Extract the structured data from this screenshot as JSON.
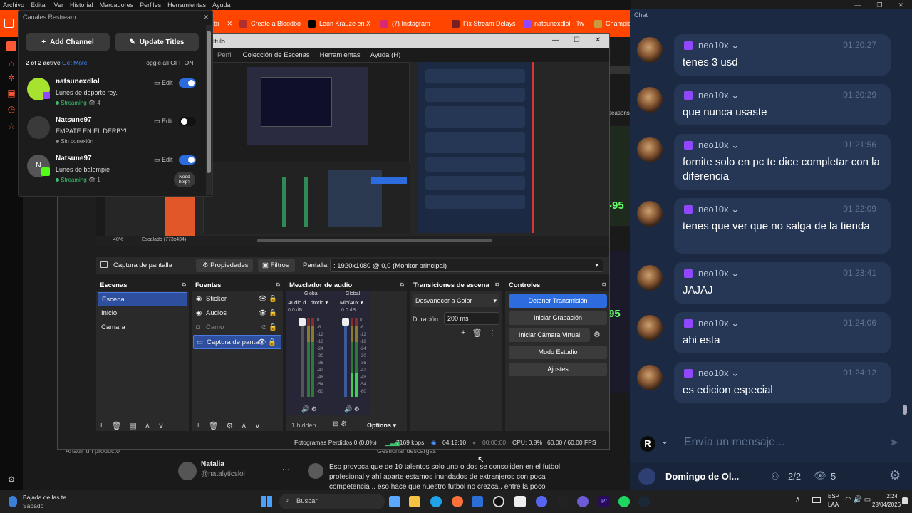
{
  "browser": {
    "menu": [
      "Archivo",
      "Editar",
      "Ver",
      "Historial",
      "Marcadores",
      "Perfiles",
      "Herramientas",
      "Ayuda"
    ],
    "tabs": [
      {
        "label": "Create a Bloodbo",
        "color": "#b03030"
      },
      {
        "label": "León Krauze en X",
        "color": "#000000"
      },
      {
        "label": "(7) Instagram",
        "color": "#d62976"
      },
      {
        "label": "Fix Stream Delays",
        "color": "#7a1f1f"
      },
      {
        "label": "natsunexdlol - Tw",
        "color": "#9146ff"
      },
      {
        "label": "Champion",
        "color": "#c89b3c"
      }
    ],
    "partial_text": {
      "seasons": "seasons",
      "ninetyfive": "-95",
      "ninetyfive2": "95"
    }
  },
  "restream": {
    "window_title": "Canales Restream",
    "add_channel": "Add Channel",
    "update_titles": "Update Titles",
    "active_count": "2 of 2 active",
    "get_more": "Get More",
    "toggle_all": "Toggle all OFF",
    "toggle_on": "ON",
    "need_help": "Need help?",
    "edit_label": "Edit",
    "channels": [
      {
        "name": "natsunexdlol",
        "title": "Lunes de deporte rey.",
        "status": "Streaming",
        "viewers": "4",
        "on": true,
        "status_color": "#3fbf6f"
      },
      {
        "name": "Natsune97",
        "title": "EMPATE EN EL DERBY!",
        "status": "Sin conexión",
        "viewers": "",
        "on": false,
        "status_color": "#888888"
      },
      {
        "name": "Natsune97",
        "title": "Lunes de balompie",
        "status": "Streaming",
        "viewers": "1",
        "on": true,
        "status_color": "#3fbf6f"
      }
    ]
  },
  "obs": {
    "title": "n Título",
    "menu": [
      "Perfil",
      "Colección de Escenas",
      "Herramientas",
      "Ayuda (H)"
    ],
    "zoom": "40%",
    "scale": "Escalado (773x434)",
    "source_bar": {
      "name": "Captura de pantalla",
      "props": "Propiedades",
      "filters": "Filtros",
      "screen_label": "Pantalla",
      "screen_value": ": 1920x1080 @ 0,0 (Monitor principal)"
    },
    "scenes": {
      "title": "Escenas",
      "items": [
        "Escena",
        "Inicio",
        "Camara"
      ]
    },
    "sources": {
      "title": "Fuentes",
      "items": [
        "Sticker",
        "Audios",
        "Camo",
        "Captura de panta"
      ]
    },
    "mixer": {
      "title": "Mezclador de audio",
      "global": "Global",
      "ch1": "Audio d...ritorio",
      "ch2": "Mic/Aux",
      "db": "0.0 dB",
      "scale": [
        "0",
        "-6",
        "-12",
        "-18",
        "-24",
        "-30",
        "-36",
        "-42",
        "-48",
        "-54",
        "-60"
      ],
      "hidden": "1 hidden",
      "options": "Options"
    },
    "transitions": {
      "title": "Transiciones de escena",
      "type": "Desvanecer a Color",
      "duration_label": "Duración",
      "duration": "200 ms"
    },
    "controls": {
      "title": "Controles",
      "buttons": [
        "Detener Transmisión",
        "Iniciar Grabación",
        "Iniciar Cámara Virtual",
        "Modo Estudio",
        "Ajustes"
      ]
    },
    "status": {
      "dropped": "Fotogramas Perdidos 0 (0,0%)",
      "kbps": "7169 kbps",
      "live_time": "04:12:10",
      "rec_time": "00:00:00",
      "cpu": "CPU: 0.8%",
      "fps": "60.00 / 60.00 FPS"
    }
  },
  "page_behind": {
    "add_product": "Añadir un producto",
    "shipping": "Gestionar descargas",
    "user_name": "Natalia",
    "user_handle": "@natalyticslol",
    "comment": "Eso provoca que de 10 talentos solo uno o dos se consoliden en el futbol profesional y ahí aparte estamos inundados de extranjeros con poca competencia .. eso hace que nuestro futbol no crezca.. entre la poco"
  },
  "chat": {
    "title": "Chat",
    "messages": [
      {
        "user": "neo10x",
        "time": "01:20:27",
        "text": "tenes 3 usd"
      },
      {
        "user": "neo10x",
        "time": "01:20:29",
        "text": "que nunca usaste"
      },
      {
        "user": "neo10x",
        "time": "01:21:56",
        "text": "fornite solo en pc te dice completar con la diferencia"
      },
      {
        "user": "neo10x",
        "time": "01:22:09",
        "text": "tenes que ver que no salga de la tienda"
      },
      {
        "user": "neo10x",
        "time": "01:23:41",
        "text": "JAJAJ"
      },
      {
        "user": "neo10x",
        "time": "01:24:06",
        "text": "ahi esta"
      },
      {
        "user": "neo10x",
        "time": "01:24:12",
        "text": "es edicion especial"
      }
    ],
    "input_placeholder": "Envía un mensaje...",
    "footer_name": "Domingo de Ol...",
    "footer_count": "2/2",
    "footer_viewers": "5"
  },
  "taskbar": {
    "weather_title": "Bajada de las te...",
    "weather_sub": "Sábado",
    "search": "Buscar",
    "lang": "ESP",
    "lang2": "LAA",
    "time": "2:24",
    "date": "28/04/2026"
  }
}
